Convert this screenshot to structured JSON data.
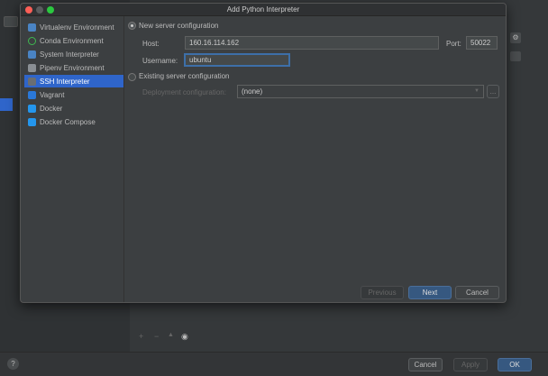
{
  "dialog": {
    "title": "Add Python Interpreter",
    "sidebar": [
      {
        "label": "Virtualenv Environment",
        "icon": "python-venv-icon"
      },
      {
        "label": "Conda Environment",
        "icon": "conda-icon"
      },
      {
        "label": "System Interpreter",
        "icon": "python-icon"
      },
      {
        "label": "Pipenv Environment",
        "icon": "pipenv-icon"
      },
      {
        "label": "SSH Interpreter",
        "icon": "terminal-icon",
        "selected": true
      },
      {
        "label": "Vagrant",
        "icon": "vagrant-icon"
      },
      {
        "label": "Docker",
        "icon": "docker-icon"
      },
      {
        "label": "Docker Compose",
        "icon": "docker-compose-icon"
      }
    ],
    "new_server_label": "New server configuration",
    "host_label": "Host:",
    "host_value": "160.16.114.162",
    "port_label": "Port:",
    "port_value": "50022",
    "username_label": "Username:",
    "username_value": "ubuntu",
    "existing_server_label": "Existing server configuration",
    "deployment_label": "Deployment configuration:",
    "deployment_value": "(none)",
    "browse_label": "...",
    "previous_label": "Previous",
    "next_label": "Next",
    "cancel_label": "Cancel"
  },
  "footer": {
    "help_label": "?",
    "cancel_label": "Cancel",
    "apply_label": "Apply",
    "ok_label": "OK"
  },
  "colors": {
    "accent": "#2f65ca",
    "primary_button": "#365880"
  }
}
